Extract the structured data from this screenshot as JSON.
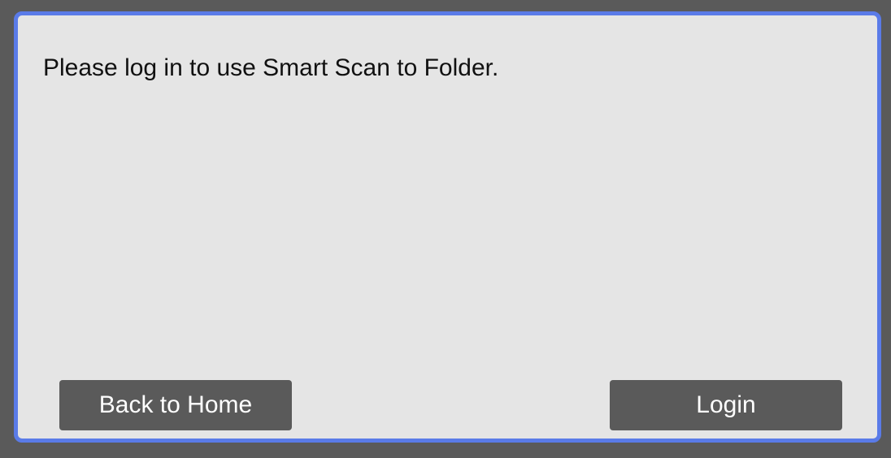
{
  "dialog": {
    "message": "Please log in to use Smart Scan to Folder."
  },
  "buttons": {
    "back_label": "Back to Home",
    "login_label": "Login"
  },
  "colors": {
    "backdrop": "#5a5a5a",
    "panel": "#e5e5e5",
    "border_accent": "#5a7be8",
    "button_bg": "#5a5a5a",
    "button_text": "#ffffff"
  }
}
